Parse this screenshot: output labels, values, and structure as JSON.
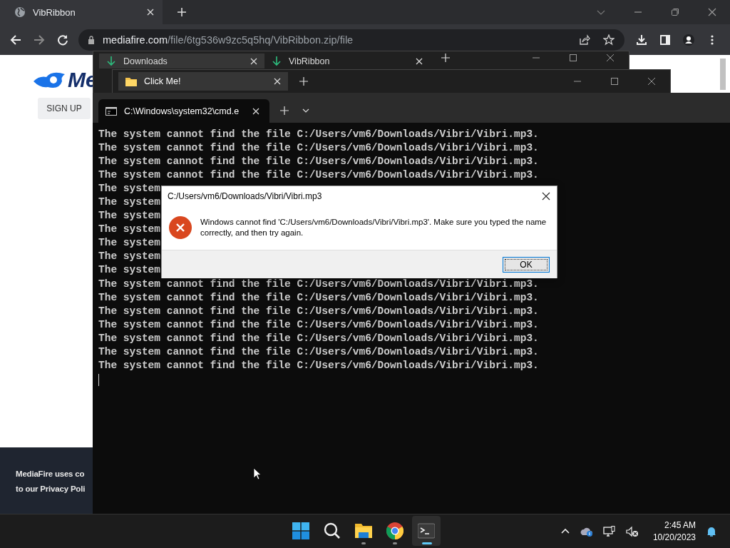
{
  "browser": {
    "tabs": [
      {
        "title": "VibRibbon",
        "selected": true
      }
    ],
    "address": {
      "host": "mediafire.com",
      "path": "/file/6tg536w9zc5q5hq/VibRibbon.zip/file"
    },
    "page": {
      "logo_text": "Me",
      "sign_up": "SIGN UP",
      "cookie_lines": [
        "MediaFire uses co",
        "to our Privacy Poli"
      ]
    }
  },
  "explorer_back": {
    "tabs": [
      {
        "label": "Downloads",
        "selected": true
      },
      {
        "label": "VibRibbon",
        "selected": false
      }
    ]
  },
  "explorer_front": {
    "tabs": [
      {
        "label": "Click Me!",
        "selected": true
      }
    ]
  },
  "terminal": {
    "tabs": [
      {
        "label": "C:\\Windows\\system32\\cmd.e",
        "selected": true
      }
    ],
    "lines": [
      "The system cannot find the file C:/Users/vm6/Downloads/Vibri/Vibri.mp3.",
      "The system cannot find the file C:/Users/vm6/Downloads/Vibri/Vibri.mp3.",
      "The system cannot find the file C:/Users/vm6/Downloads/Vibri/Vibri.mp3.",
      "The system cannot find the file C:/Users/vm6/Downloads/Vibri/Vibri.mp3.",
      "The system",
      "The system",
      "The system",
      "The system",
      "The system",
      "The system",
      "The system",
      "The system cannot find the file C:/Users/vm6/Downloads/Vibri/Vibri.mp3.",
      "The system cannot find the file C:/Users/vm6/Downloads/Vibri/Vibri.mp3.",
      "The system cannot find the file C:/Users/vm6/Downloads/Vibri/Vibri.mp3.",
      "The system cannot find the file C:/Users/vm6/Downloads/Vibri/Vibri.mp3.",
      "The system cannot find the file C:/Users/vm6/Downloads/Vibri/Vibri.mp3.",
      "The system cannot find the file C:/Users/vm6/Downloads/Vibri/Vibri.mp3.",
      "The system cannot find the file C:/Users/vm6/Downloads/Vibri/Vibri.mp3."
    ]
  },
  "dialog": {
    "title": "C:/Users/vm6/Downloads/Vibri/Vibri.mp3",
    "message": "Windows cannot find 'C:/Users/vm6/Downloads/Vibri/Vibri.mp3'. Make sure you typed the name correctly, and then try again.",
    "button": "OK"
  },
  "taskbar": {
    "apps": [
      {
        "kind": "start",
        "selected": false,
        "running": false
      },
      {
        "kind": "search",
        "selected": false,
        "running": false
      },
      {
        "kind": "files",
        "selected": false,
        "running": true
      },
      {
        "kind": "browser",
        "selected": false,
        "running": true
      },
      {
        "kind": "terminal",
        "selected": true,
        "running": true
      }
    ],
    "time": "2:45 AM",
    "date": "10/20/2023"
  }
}
